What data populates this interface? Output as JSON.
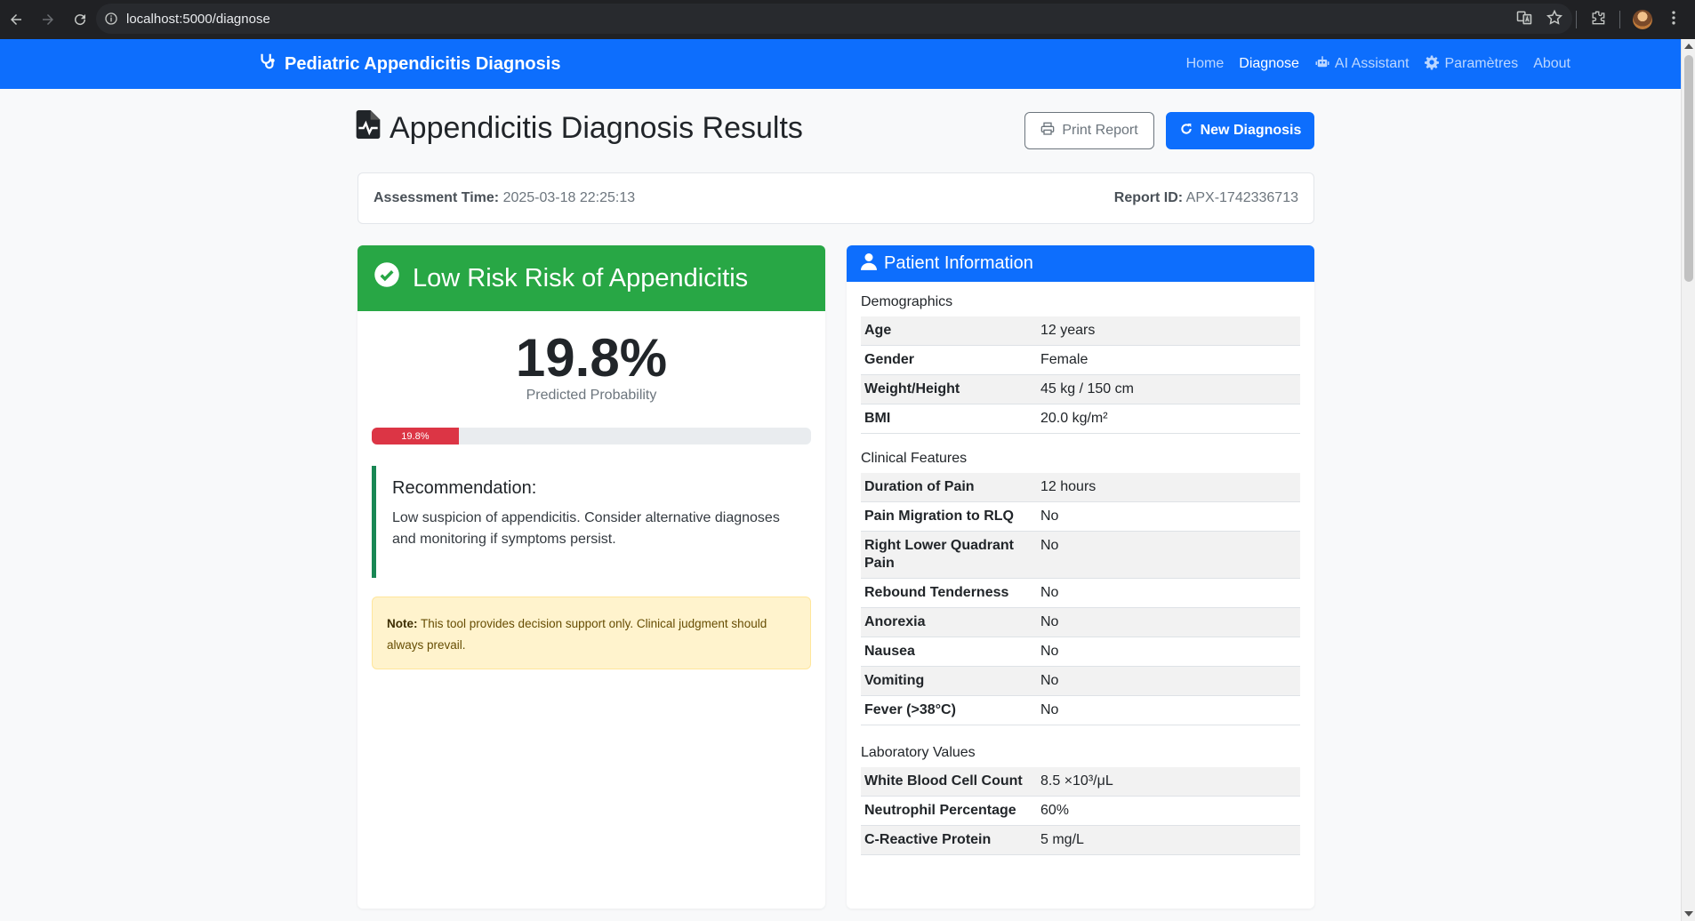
{
  "browser": {
    "url": "localhost:5000/diagnose"
  },
  "navbar": {
    "brand": "Pediatric Appendicitis Diagnosis",
    "links": [
      {
        "label": "Home",
        "icon": ""
      },
      {
        "label": "Diagnose",
        "icon": "",
        "active": true
      },
      {
        "label": "AI Assistant",
        "icon": "robot-icon"
      },
      {
        "label": "Paramètres",
        "icon": "gear-icon"
      },
      {
        "label": "About",
        "icon": ""
      }
    ]
  },
  "page": {
    "title": "Appendicitis Diagnosis Results",
    "print_label": "Print Report",
    "new_label": "New Diagnosis"
  },
  "meta": {
    "assessment_label": "Assessment Time:",
    "assessment_value": "2025-03-18 22:25:13",
    "report_label": "Report ID:",
    "report_value": "APX-1742336713"
  },
  "risk": {
    "title": "Low Risk Risk of Appendicitis",
    "probability": "19.8%",
    "probability_fraction": 0.198,
    "probability_label": "Predicted Probability",
    "bar_label": "19.8%",
    "header_color": "#28a745",
    "bar_color": "#dc3545",
    "recommendation_title": "Recommendation:",
    "recommendation_text": "Low suspicion of appendicitis. Consider alternative diagnoses and monitoring if symptoms persist.",
    "note_label": "Note:",
    "note_text": " This tool provides decision support only. Clinical judgment should always prevail."
  },
  "patient": {
    "title": "Patient Information",
    "demographics_title": "Demographics",
    "demographics": [
      {
        "label": "Age",
        "value": "12 years"
      },
      {
        "label": "Gender",
        "value": "Female"
      },
      {
        "label": "Weight/Height",
        "value": "45 kg / 150 cm"
      },
      {
        "label": "BMI",
        "value": "20.0 kg/m²"
      }
    ],
    "clinical_title": "Clinical Features",
    "clinical": [
      {
        "label": "Duration of Pain",
        "value": "12 hours"
      },
      {
        "label": "Pain Migration to RLQ",
        "value": "No"
      },
      {
        "label": "Right Lower Quadrant Pain",
        "value": "No"
      },
      {
        "label": "Rebound Tenderness",
        "value": "No"
      },
      {
        "label": "Anorexia",
        "value": "No"
      },
      {
        "label": "Nausea",
        "value": "No"
      },
      {
        "label": "Vomiting",
        "value": "No"
      },
      {
        "label": "Fever (>38°C)",
        "value": "No"
      }
    ],
    "lab_title": "Laboratory Values",
    "lab": [
      {
        "label": "White Blood Cell Count",
        "value": "8.5 ×10³/μL"
      },
      {
        "label": "Neutrophil Percentage",
        "value": "60%"
      },
      {
        "label": "C-Reactive Protein",
        "value": "5 mg/L"
      }
    ]
  }
}
